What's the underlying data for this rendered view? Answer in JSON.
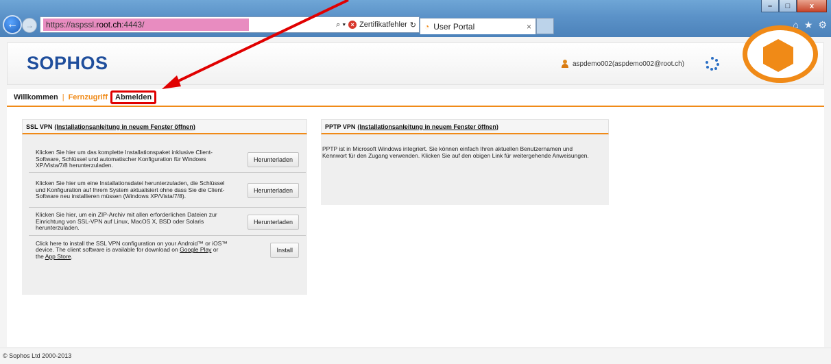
{
  "browser": {
    "url_prefix": "https://aspssl.",
    "url_host": "root.ch",
    "url_suffix": ":4443/",
    "certificate_error": "Zertifikatfehler",
    "tab_title": "User Portal",
    "tab_close": "×",
    "window_buttons": {
      "minimize": "–",
      "maximize": "□",
      "close": "x"
    }
  },
  "header": {
    "logo": "SOPHOS",
    "user": "aspdemo002(aspdemo002@root.ch)"
  },
  "nav": {
    "items": [
      {
        "label": "Willkommen"
      },
      {
        "label": "Fernzugriff"
      },
      {
        "label": "Abmelden"
      }
    ]
  },
  "ssl_vpn": {
    "title": "SSL VPN",
    "link": "(Installationsanleitung in neuem Fenster öffnen)",
    "rows": [
      {
        "text": "Klicken Sie hier um das komplette Installationspaket inklusive Client-Software, Schlüssel und automatischer Konfiguration für Windows XP/Vista/7/8 herunterzuladen.",
        "button": "Herunterladen"
      },
      {
        "text": "Klicken Sie hier um eine Installationsdatei herunterzuladen, die Schlüssel und Konfiguration auf Ihrem System aktualisiert ohne dass Sie die Client-Software neu installieren müssen (Windows XP/Vista/7/8).",
        "button": "Herunterladen"
      },
      {
        "text": "Klicken Sie hier, um ein ZIP-Archiv mit allen erforderlichen Dateien zur Einrichtung von SSL-VPN auf Linux, MacOS X, BSD oder Solaris herunterzuladen.",
        "button": "Herunterladen"
      },
      {
        "text_a": "Click here to install the SSL VPN configuration on your Android™ or iOS™ device. The client software is available for download on",
        "link_a": "Google Play",
        "text_b": "or the",
        "link_b": "App Store",
        "text_c": ".",
        "button": "Install"
      }
    ]
  },
  "pptp_vpn": {
    "title": "PPTP VPN",
    "link": "(Installationsanleitung in neuem Fenster öffnen)",
    "text": "PPTP ist in Microsoft Windows integriert. Sie können einfach Ihren aktuellen Benutzernamen und Kennwort für den Zugang verwenden. Klicken Sie auf den obigen Link für weitergehende Anweisungen."
  },
  "footer": {
    "copyright": "© Sophos Ltd 2000-2013"
  },
  "colors": {
    "accent": "#f08a17",
    "logo": "#1f4e9c",
    "annotation": "#e00000"
  }
}
